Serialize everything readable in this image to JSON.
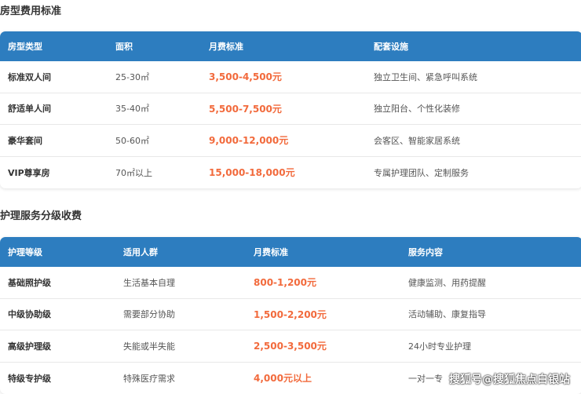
{
  "section1": {
    "title": "房型费用标准",
    "headers": [
      "房型类型",
      "面积",
      "月费标准",
      "配套设施"
    ],
    "rows": [
      [
        "标准双人间",
        "25-30㎡",
        "3,500-4,500元",
        "独立卫生间、紧急呼叫系统"
      ],
      [
        "舒适单人间",
        "35-40㎡",
        "5,500-7,500元",
        "独立阳台、个性化装修"
      ],
      [
        "豪华套间",
        "50-60㎡",
        "9,000-12,000元",
        "会客区、智能家居系统"
      ],
      [
        "VIP尊享房",
        "70㎡以上",
        "15,000-18,000元",
        "专属护理团队、定制服务"
      ]
    ]
  },
  "section2": {
    "title": "护理服务分级收费",
    "headers": [
      "护理等级",
      "适用人群",
      "月费标准",
      "服务内容"
    ],
    "rows": [
      [
        "基础照护级",
        "生活基本自理",
        "800-1,200元",
        "健康监测、用药提醒"
      ],
      [
        "中级协助级",
        "需要部分协助",
        "1,500-2,200元",
        "活动辅助、康复指导"
      ],
      [
        "高级护理级",
        "失能或半失能",
        "2,500-3,500元",
        "24小时专业护理"
      ],
      [
        "特级专护级",
        "特殊医疗需求",
        "4,000元以上",
        "一对一专"
      ]
    ]
  },
  "watermark": "搜狐号@搜狐焦点白银站",
  "colors": {
    "header": "#2d7dbf",
    "price": "#f26a3c"
  }
}
